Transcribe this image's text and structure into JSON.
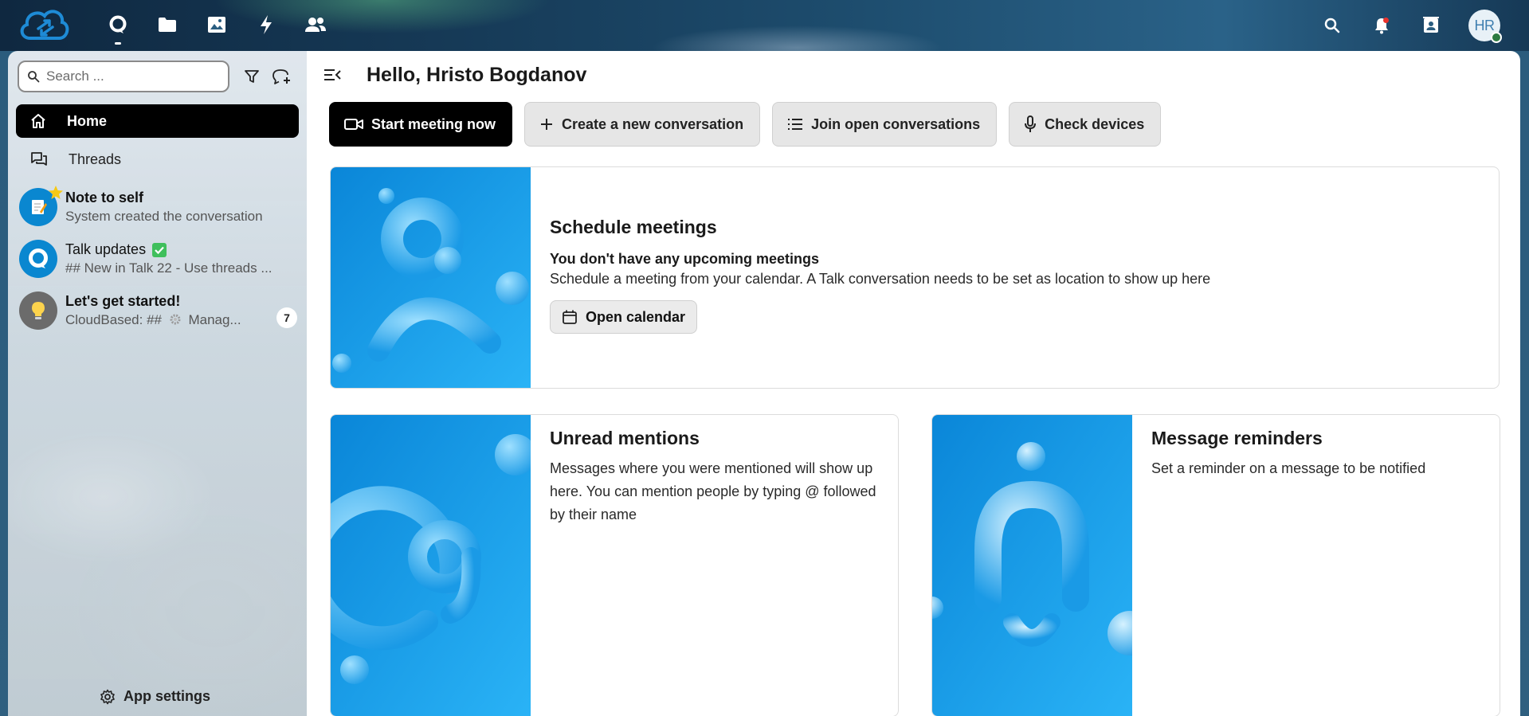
{
  "topbar": {
    "apps": [
      {
        "name": "talk",
        "icon": "talk-icon",
        "active": true
      },
      {
        "name": "files",
        "icon": "folder-icon"
      },
      {
        "name": "photos",
        "icon": "image-icon"
      },
      {
        "name": "activity",
        "icon": "bolt-icon"
      },
      {
        "name": "contacts",
        "icon": "people-icon"
      }
    ],
    "avatar_initials": "HR"
  },
  "sidebar": {
    "search_placeholder": "Search ...",
    "nav": [
      {
        "label": "Home",
        "icon": "home-icon",
        "active": true
      },
      {
        "label": "Threads",
        "icon": "threads-icon",
        "active": false
      }
    ],
    "conversations": [
      {
        "title": "Note to self",
        "subtitle": "System created the conversation",
        "avatar_icon": "notepad-icon",
        "avatar_color": "#0082c9",
        "favorite": true
      },
      {
        "title": "Talk updates",
        "subtitle": "## New in Talk 22 - Use threads ...",
        "avatar_icon": "talk-logo-icon",
        "avatar_color": "#0082c9",
        "verified": true
      },
      {
        "title": "Let's get started!",
        "subtitle_prefix": "CloudBased: ##",
        "subtitle_suffix": "Manag...",
        "avatar_icon": "lightbulb-icon",
        "avatar_color": "#6b6b6b",
        "unread": "7"
      }
    ],
    "app_settings": "App settings"
  },
  "main": {
    "greeting": "Hello, Hristo Bogdanov",
    "actions": {
      "start_meeting": "Start meeting now",
      "create_conversation": "Create a new conversation",
      "join_open": "Join open conversations",
      "check_devices": "Check devices"
    },
    "schedule": {
      "title": "Schedule meetings",
      "subtitle": "You don't have any upcoming meetings",
      "text": "Schedule a meeting from your calendar. A Talk conversation needs to be set as location to show up here",
      "button": "Open calendar"
    },
    "mentions": {
      "title": "Unread mentions",
      "text": "Messages where you were mentioned will show up here. You can mention people by typing @ followed by their name"
    },
    "reminders": {
      "title": "Message reminders",
      "text": "Set a reminder on a message to be notified"
    }
  },
  "colors": {
    "brand": "#0082c9",
    "primary_button": "#000000",
    "illustration_blue": "#1aa3f0"
  }
}
